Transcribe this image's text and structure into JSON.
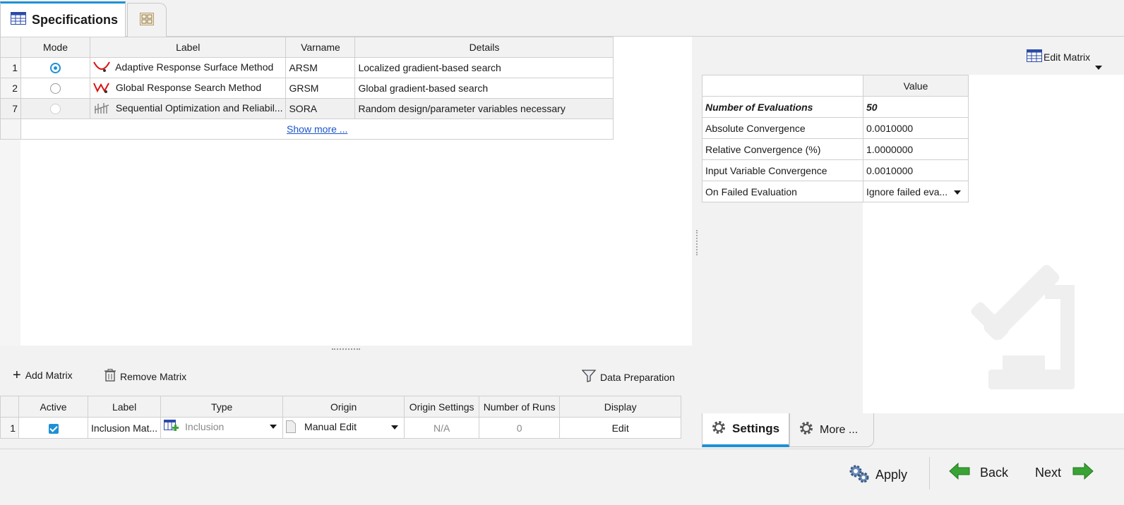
{
  "tabs": {
    "specifications": "Specifications"
  },
  "methods": {
    "columns": [
      "Mode",
      "Label",
      "Varname",
      "Details"
    ],
    "rows": [
      {
        "num": "1",
        "label": "Adaptive Response Surface Method",
        "varname": "ARSM",
        "details": "Localized gradient-based search",
        "selected": true
      },
      {
        "num": "2",
        "label": "Global Response Search Method",
        "varname": "GRSM",
        "details": "Global gradient-based search",
        "selected": false
      },
      {
        "num": "7",
        "label": "Sequential Optimization and Reliabil...",
        "varname": "SORA",
        "details": "Random design/parameter variables necessary",
        "selected": false
      }
    ],
    "show_more": "Show more ..."
  },
  "toolbar": {
    "add_matrix": "Add Matrix",
    "remove_matrix": "Remove Matrix",
    "data_preparation": "Data Preparation"
  },
  "matrix": {
    "columns": [
      "Active",
      "Label",
      "Type",
      "Origin",
      "Origin Settings",
      "Number of Runs",
      "Display"
    ],
    "rows": [
      {
        "num": "1",
        "active": true,
        "label": "Inclusion Mat...",
        "type": "Inclusion",
        "origin": "Manual Edit",
        "origin_settings": "N/A",
        "runs": "0",
        "display": "Edit"
      }
    ]
  },
  "settings_panel": {
    "edit_matrix": "Edit Matrix",
    "value_header": "Value",
    "rows": [
      {
        "label": "Number of Evaluations",
        "value": "50"
      },
      {
        "label": "Absolute Convergence",
        "value": "0.0010000"
      },
      {
        "label": "Relative Convergence (%)",
        "value": "1.0000000"
      },
      {
        "label": "Input Variable Convergence",
        "value": "0.0010000"
      },
      {
        "label": "On Failed Evaluation",
        "value": "Ignore failed eva..."
      }
    ]
  },
  "bottom_tabs": {
    "settings": "Settings",
    "more": "More ..."
  },
  "footer": {
    "apply": "Apply",
    "back": "Back",
    "next": "Next"
  },
  "colors": {
    "accent": "#1e90d6",
    "link": "#1b55c9",
    "arrow_green": "#3aa335"
  }
}
